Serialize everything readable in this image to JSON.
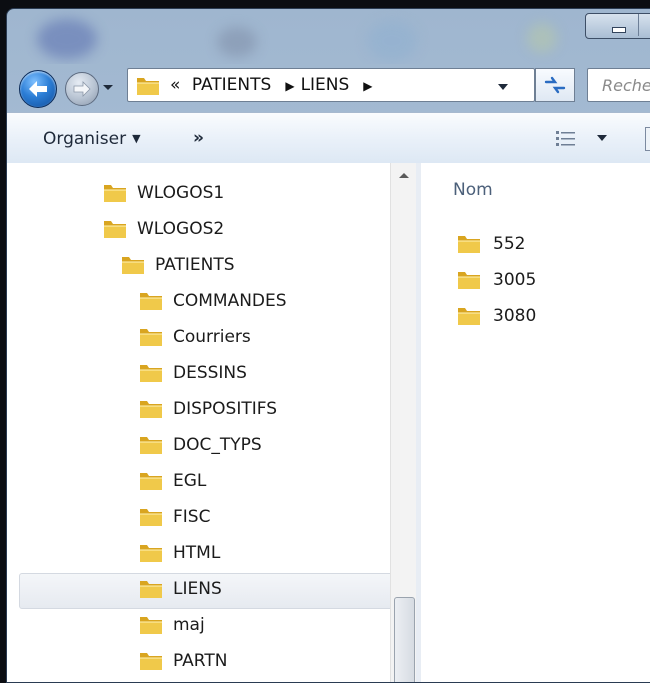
{
  "address": {
    "overflow": "«",
    "crumbs": [
      "PATIENTS",
      "LIENS"
    ]
  },
  "search": {
    "placeholder": "Reche"
  },
  "toolbar": {
    "organise_label": "Organiser",
    "more_label": "»"
  },
  "nav_tree": [
    {
      "label": "WLOGOS1",
      "level": 0
    },
    {
      "label": "WLOGOS2",
      "level": 0
    },
    {
      "label": "PATIENTS",
      "level": 1
    },
    {
      "label": "COMMANDES",
      "level": 2
    },
    {
      "label": "Courriers",
      "level": 2
    },
    {
      "label": "DESSINS",
      "level": 2
    },
    {
      "label": "DISPOSITIFS",
      "level": 2
    },
    {
      "label": "DOC_TYPS",
      "level": 2
    },
    {
      "label": "EGL",
      "level": 2
    },
    {
      "label": "FISC",
      "level": 2
    },
    {
      "label": "HTML",
      "level": 2
    },
    {
      "label": "LIENS",
      "level": 2,
      "selected": true
    },
    {
      "label": "maj",
      "level": 2
    },
    {
      "label": "PARTN",
      "level": 2
    }
  ],
  "content": {
    "column_header": "Nom",
    "items": [
      {
        "label": "552"
      },
      {
        "label": "3005"
      },
      {
        "label": "3080"
      }
    ]
  },
  "colors": {
    "folder_front": "#f0c94a",
    "folder_back": "#d9a520",
    "selection": "#e6eaf0"
  },
  "icons": {
    "back": "back-arrow-icon",
    "forward": "forward-arrow-icon",
    "folder": "folder-icon",
    "refresh": "refresh-icon",
    "views": "view-options-icon"
  }
}
